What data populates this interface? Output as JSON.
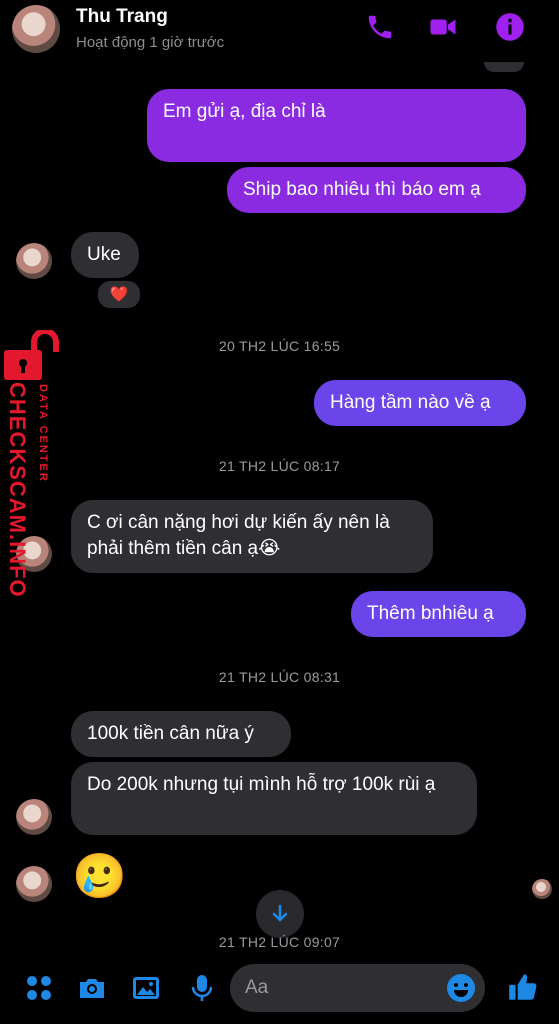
{
  "header": {
    "contact_name": "Thu Trang",
    "status": "Hoạt động 1 giờ trước",
    "icons": [
      "phone-icon",
      "video-call-icon",
      "info-icon"
    ],
    "accent_color": "#a020f0"
  },
  "messages": [
    {
      "dir": "out",
      "text": "Em gửi ạ, địa chỉ là"
    },
    {
      "dir": "out",
      "text": "Ship bao nhiêu thì báo em ạ"
    },
    {
      "dir": "in",
      "text": "Uke",
      "reaction": "❤️"
    },
    {
      "timestamp": "20 TH2 LÚC 16:55"
    },
    {
      "dir": "out",
      "text": "Hàng tầm nào về ạ"
    },
    {
      "timestamp": "21 TH2 LÚC 08:17"
    },
    {
      "dir": "in",
      "text": "C ơi cân nặng hơi dự kiến ấy nên là phải thêm tiền cân ạ😭"
    },
    {
      "dir": "out",
      "text": "Thêm bnhiêu ạ"
    },
    {
      "timestamp": "21 TH2 LÚC 08:31"
    },
    {
      "dir": "in",
      "text": "100k tiền cân nữa ý"
    },
    {
      "dir": "in",
      "text": "Do 200k nhưng tụi mình hỗ trợ 100k rùi ạ"
    },
    {
      "dir": "in",
      "text": "🥲"
    },
    {
      "timestamp": "21 TH2 LÚC 09:07"
    }
  ],
  "watermark": {
    "main": "CHECKSCAM.INFO",
    "sub": "DATA CENTER"
  },
  "composer": {
    "placeholder": "Aa",
    "icons": [
      "apps-icon",
      "camera-icon",
      "image-icon",
      "microphone-icon",
      "emoji-icon",
      "like-icon"
    ],
    "accent_color": "#1e88e5"
  }
}
